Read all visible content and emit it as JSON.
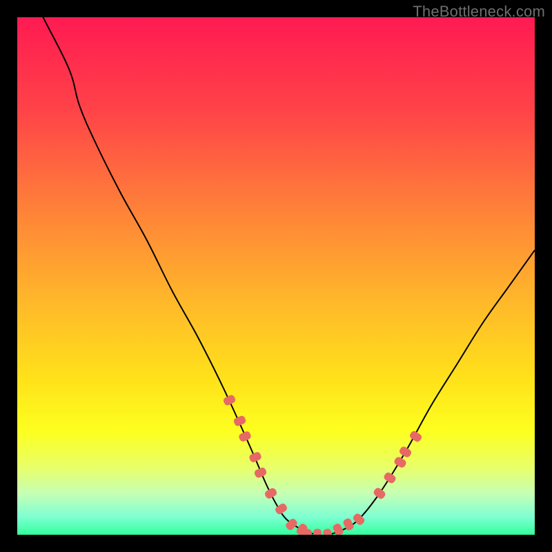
{
  "watermark": "TheBottleneck.com",
  "colors": {
    "frame": "#000000",
    "curve_stroke": "#000000",
    "marker_fill": "#e66a63",
    "gradient_stops": [
      {
        "offset": 0,
        "color": "#ff1a52"
      },
      {
        "offset": 0.18,
        "color": "#ff4348"
      },
      {
        "offset": 0.38,
        "color": "#ff8438"
      },
      {
        "offset": 0.55,
        "color": "#ffb82a"
      },
      {
        "offset": 0.7,
        "color": "#ffe21a"
      },
      {
        "offset": 0.8,
        "color": "#fdff1f"
      },
      {
        "offset": 0.87,
        "color": "#e8ff69"
      },
      {
        "offset": 0.92,
        "color": "#c6ffb5"
      },
      {
        "offset": 0.965,
        "color": "#7fffd2"
      },
      {
        "offset": 1.0,
        "color": "#33ff9e"
      }
    ]
  },
  "chart_data": {
    "type": "line",
    "title": "",
    "xlabel": "",
    "ylabel": "",
    "xlim": [
      0,
      100
    ],
    "ylim": [
      0,
      100
    ],
    "series": [
      {
        "name": "bottleneck-curve",
        "x": [
          0,
          5,
          10,
          12,
          15,
          20,
          25,
          30,
          35,
          40,
          45,
          48,
          50,
          52,
          55,
          58,
          60,
          63,
          66,
          70,
          75,
          80,
          85,
          90,
          95,
          100
        ],
        "y": [
          110,
          100,
          90,
          83,
          76,
          66,
          57,
          47,
          38,
          28,
          17,
          10,
          6,
          3,
          1,
          0,
          0,
          1,
          3,
          8,
          16,
          25,
          33,
          41,
          48,
          55
        ]
      }
    ],
    "markers": {
      "name": "highlight-dots",
      "points": [
        {
          "x": 41,
          "y": 26
        },
        {
          "x": 43,
          "y": 22
        },
        {
          "x": 44,
          "y": 19
        },
        {
          "x": 46,
          "y": 15
        },
        {
          "x": 47,
          "y": 12
        },
        {
          "x": 49,
          "y": 8
        },
        {
          "x": 51,
          "y": 5
        },
        {
          "x": 53,
          "y": 2
        },
        {
          "x": 55,
          "y": 1
        },
        {
          "x": 56,
          "y": 0
        },
        {
          "x": 58,
          "y": 0
        },
        {
          "x": 60,
          "y": 0
        },
        {
          "x": 62,
          "y": 1
        },
        {
          "x": 64,
          "y": 2
        },
        {
          "x": 66,
          "y": 3
        },
        {
          "x": 70,
          "y": 8
        },
        {
          "x": 72,
          "y": 11
        },
        {
          "x": 74,
          "y": 14
        },
        {
          "x": 75,
          "y": 16
        },
        {
          "x": 77,
          "y": 19
        }
      ]
    }
  }
}
